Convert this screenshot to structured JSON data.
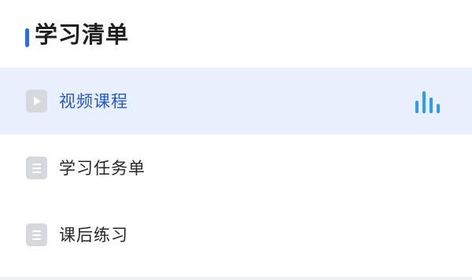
{
  "header": {
    "title": "学习清单",
    "accent_color": "#2f6bdc"
  },
  "items": [
    {
      "label": "视频课程",
      "icon": "video-play-icon",
      "active": true,
      "status_icon": "playing-equalizer-icon"
    },
    {
      "label": "学习任务单",
      "icon": "document-icon",
      "active": false
    },
    {
      "label": "课后练习",
      "icon": "document-icon",
      "active": false
    }
  ],
  "colors": {
    "active_background": "#e8effd",
    "active_text": "#2859c5",
    "equalizer": "#2e9af0",
    "icon_gray": "#d6d8de"
  }
}
